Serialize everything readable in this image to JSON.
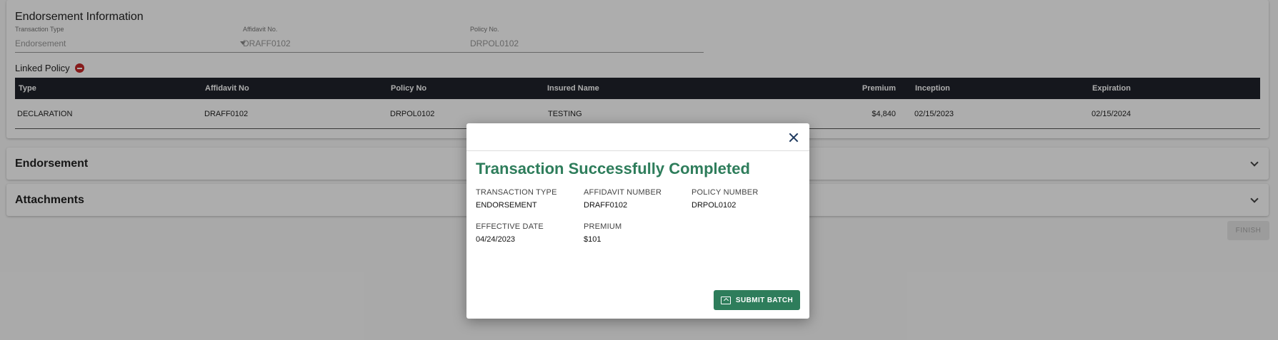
{
  "endorsement_info": {
    "title": "Endorsement Information",
    "transaction_type": {
      "label": "Transaction Type",
      "value": "Endorsement"
    },
    "affidavit_no": {
      "label": "Affidavit No.",
      "value": "DRAFF0102"
    },
    "policy_no": {
      "label": "Policy No.",
      "value": "DRPOL0102"
    },
    "linked_policy_label": "Linked Policy"
  },
  "table": {
    "headers": [
      "Type",
      "Affidavit No",
      "Policy No",
      "Insured Name",
      "Premium",
      "Inception",
      "Expiration"
    ],
    "rows": [
      [
        "DECLARATION",
        "DRAFF0102",
        "DRPOL0102",
        "TESTING",
        "$4,840",
        "02/15/2023",
        "02/15/2024"
      ]
    ]
  },
  "sections": {
    "endorsement": "Endorsement",
    "attachments": "Attachments"
  },
  "finish_label": "FINISH",
  "modal": {
    "title": "Transaction Successfully Completed",
    "fields": [
      {
        "label": "TRANSACTION TYPE",
        "value": "ENDORSEMENT"
      },
      {
        "label": "AFFIDAVIT NUMBER",
        "value": "DRAFF0102"
      },
      {
        "label": "POLICY NUMBER",
        "value": "DRPOL0102"
      },
      {
        "label": "EFFECTIVE DATE",
        "value": "04/24/2023"
      },
      {
        "label": "PREMIUM",
        "value": "$101"
      }
    ],
    "submit_label": "SUBMIT BATCH"
  },
  "colors": {
    "accent": "#2e7d5b",
    "table_header": "#1f232b",
    "remove": "#c62828"
  }
}
